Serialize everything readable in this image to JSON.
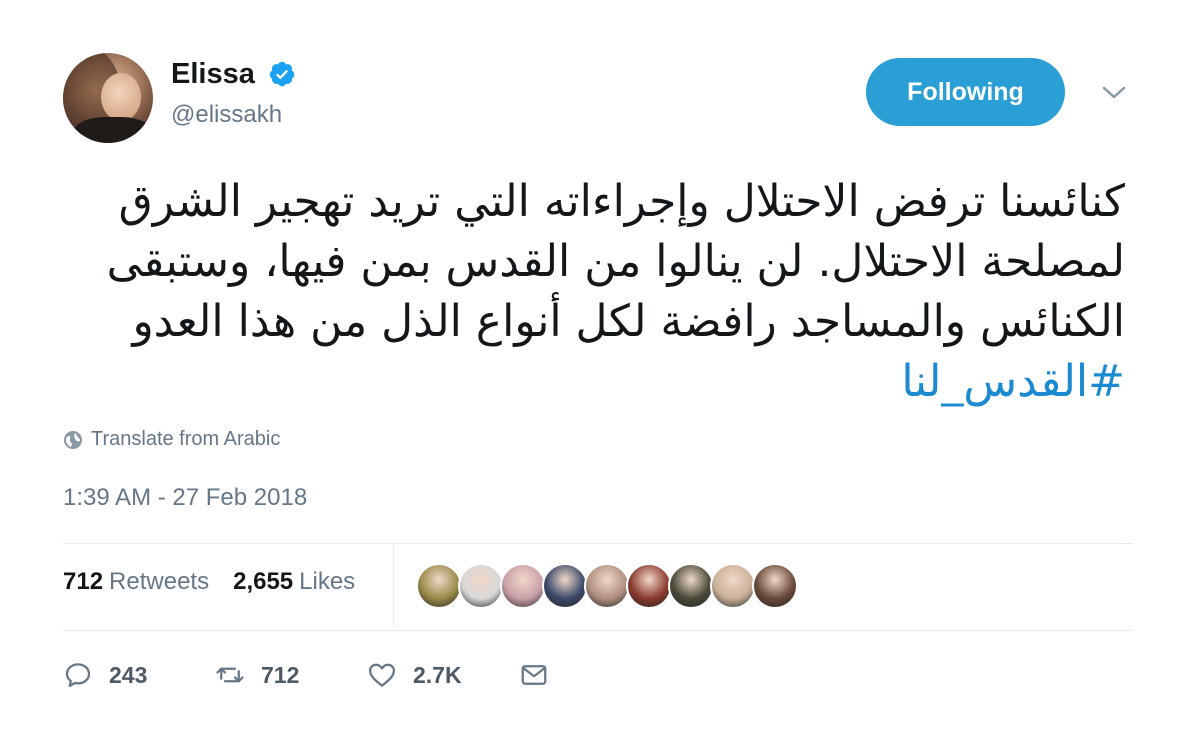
{
  "user": {
    "display_name": "Elissa",
    "handle": "@elissakh",
    "verified": true
  },
  "follow_button": {
    "label": "Following"
  },
  "tweet": {
    "text": "كنائسنا ترفض الاحتلال وإجراءاته التي تريد تهجير الشرق لمصلحة الاحتلال. لن ينالوا من القدس بمن فيها، وستبقى الكنائس والمساجد رافضة لكل أنواع الذل من هذا العدو",
    "hashtag": "#القدس_لنا",
    "translate_label": "Translate from Arabic",
    "timestamp": "1:39 AM - 27 Feb 2018"
  },
  "stats": {
    "retweets_count": "712",
    "retweets_label": "Retweets",
    "likes_count": "2,655",
    "likes_label": "Likes"
  },
  "liker_avatars": [
    {
      "color": "#9a8a4a"
    },
    {
      "color": "#d8d8d8"
    },
    {
      "color": "#c9a0a8"
    },
    {
      "color": "#3c4a6a"
    },
    {
      "color": "#b09080"
    },
    {
      "color": "#8a3a2e"
    },
    {
      "color": "#4a4a3a"
    },
    {
      "color": "#c8b098"
    },
    {
      "color": "#6a4a3a"
    }
  ],
  "actions": {
    "replies": "243",
    "retweets": "712",
    "likes": "2.7K"
  },
  "colors": {
    "accent": "#1da1f2",
    "hashtag": "#1b95e0",
    "secondary_text": "#657786"
  }
}
